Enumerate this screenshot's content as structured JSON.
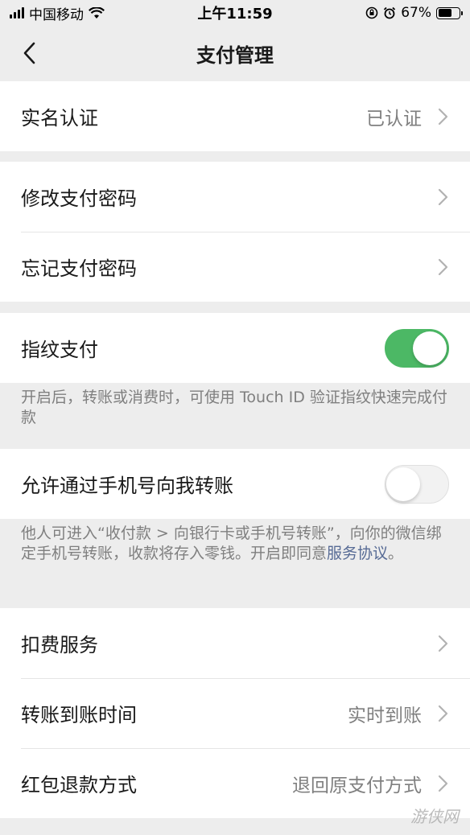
{
  "status_bar": {
    "carrier": "中国移动",
    "time": "上午11:59",
    "battery": "67%",
    "battery_level": 0.67
  },
  "nav": {
    "title": "支付管理"
  },
  "group1": {
    "realname_label": "实名认证",
    "realname_value": "已认证"
  },
  "group2": {
    "change_pwd_label": "修改支付密码",
    "forgot_pwd_label": "忘记支付密码"
  },
  "fingerprint": {
    "label": "指纹支付",
    "enabled": true,
    "note": "开启后，转账或消费时，可使用 Touch ID 验证指纹快速完成付款"
  },
  "phone_transfer": {
    "label": "允许通过手机号向我转账",
    "enabled": false,
    "note_text": "他人可进入“收付款 > 向银行卡或手机号转账”，向你的微信绑定手机号转账，收款将存入零钱。开启即同意",
    "note_link": "服务协议",
    "note_end": "。"
  },
  "group3": {
    "deduction_label": "扣费服务",
    "arrival_label": "转账到账时间",
    "arrival_value": "实时到账",
    "refund_label": "红包退款方式",
    "refund_value": "退回原支付方式"
  },
  "watermark": "游侠网",
  "colors": {
    "toggle_on": "#4cb865",
    "link": "#576b95",
    "background": "#ededed"
  }
}
